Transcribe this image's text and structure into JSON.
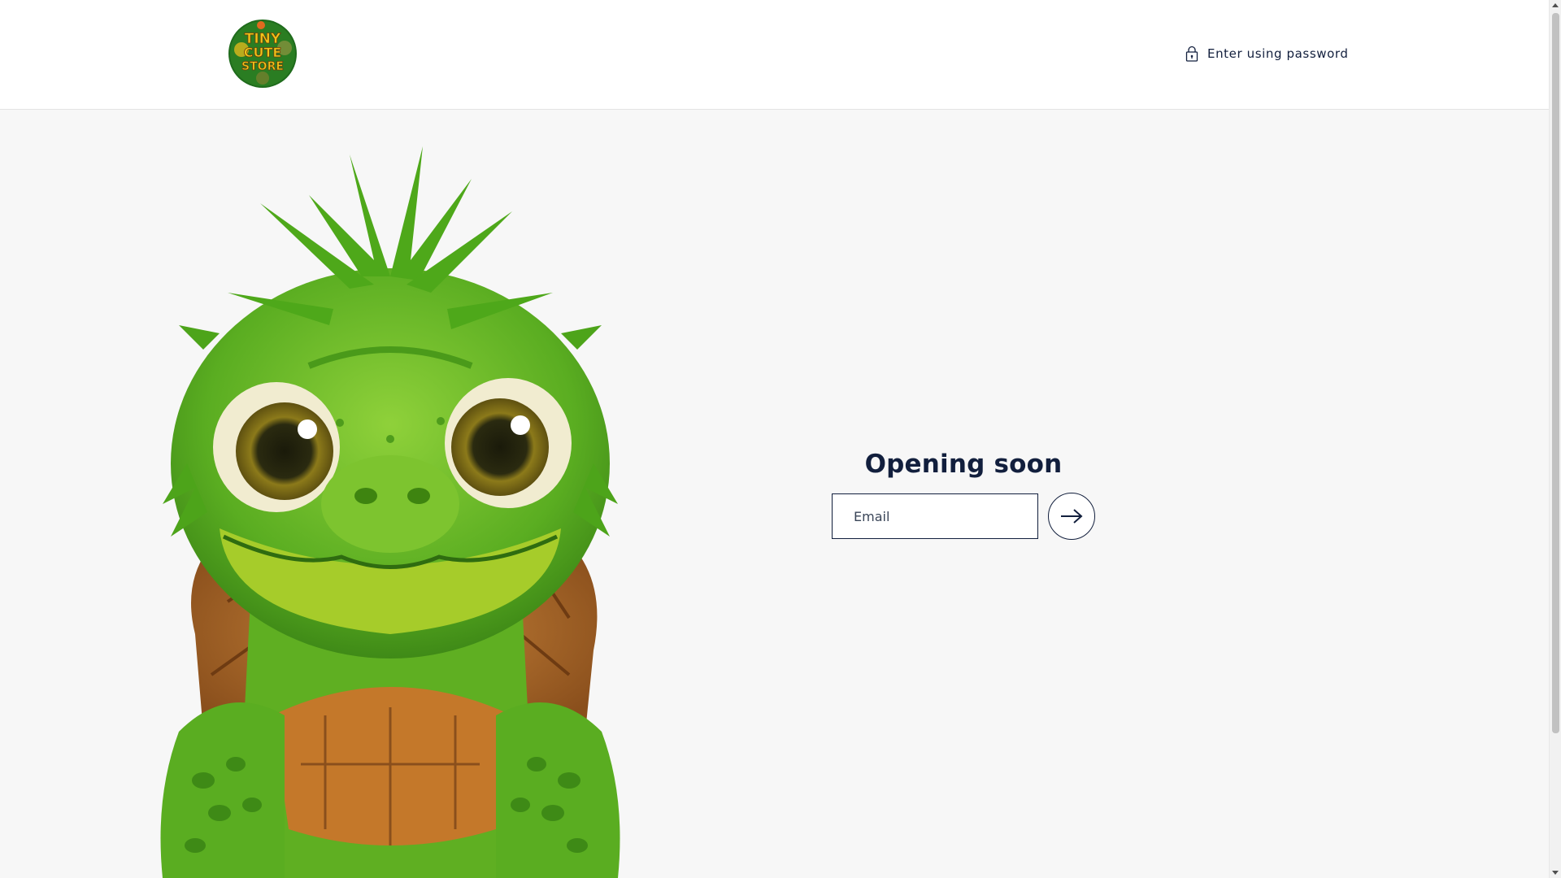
{
  "header": {
    "logo": {
      "line1": "TINY",
      "line2": "CUTE",
      "line3": "STORE",
      "bg_color": "#1f6b1c",
      "text_color": "#f2c418"
    },
    "password_link": {
      "label": "Enter using password",
      "icon": "lock-icon"
    }
  },
  "main": {
    "hero_image": {
      "subject": "turtle-mascot",
      "skin_color": "#62b824",
      "shell_color": "#a8652a"
    },
    "signup": {
      "title": "Opening soon",
      "email_placeholder": "Email",
      "email_value": "",
      "submit_icon": "arrow-right-icon"
    }
  },
  "colors": {
    "primary_text": "#121f3d",
    "page_bg": "#f7f7f7",
    "header_bg": "#ffffff"
  }
}
